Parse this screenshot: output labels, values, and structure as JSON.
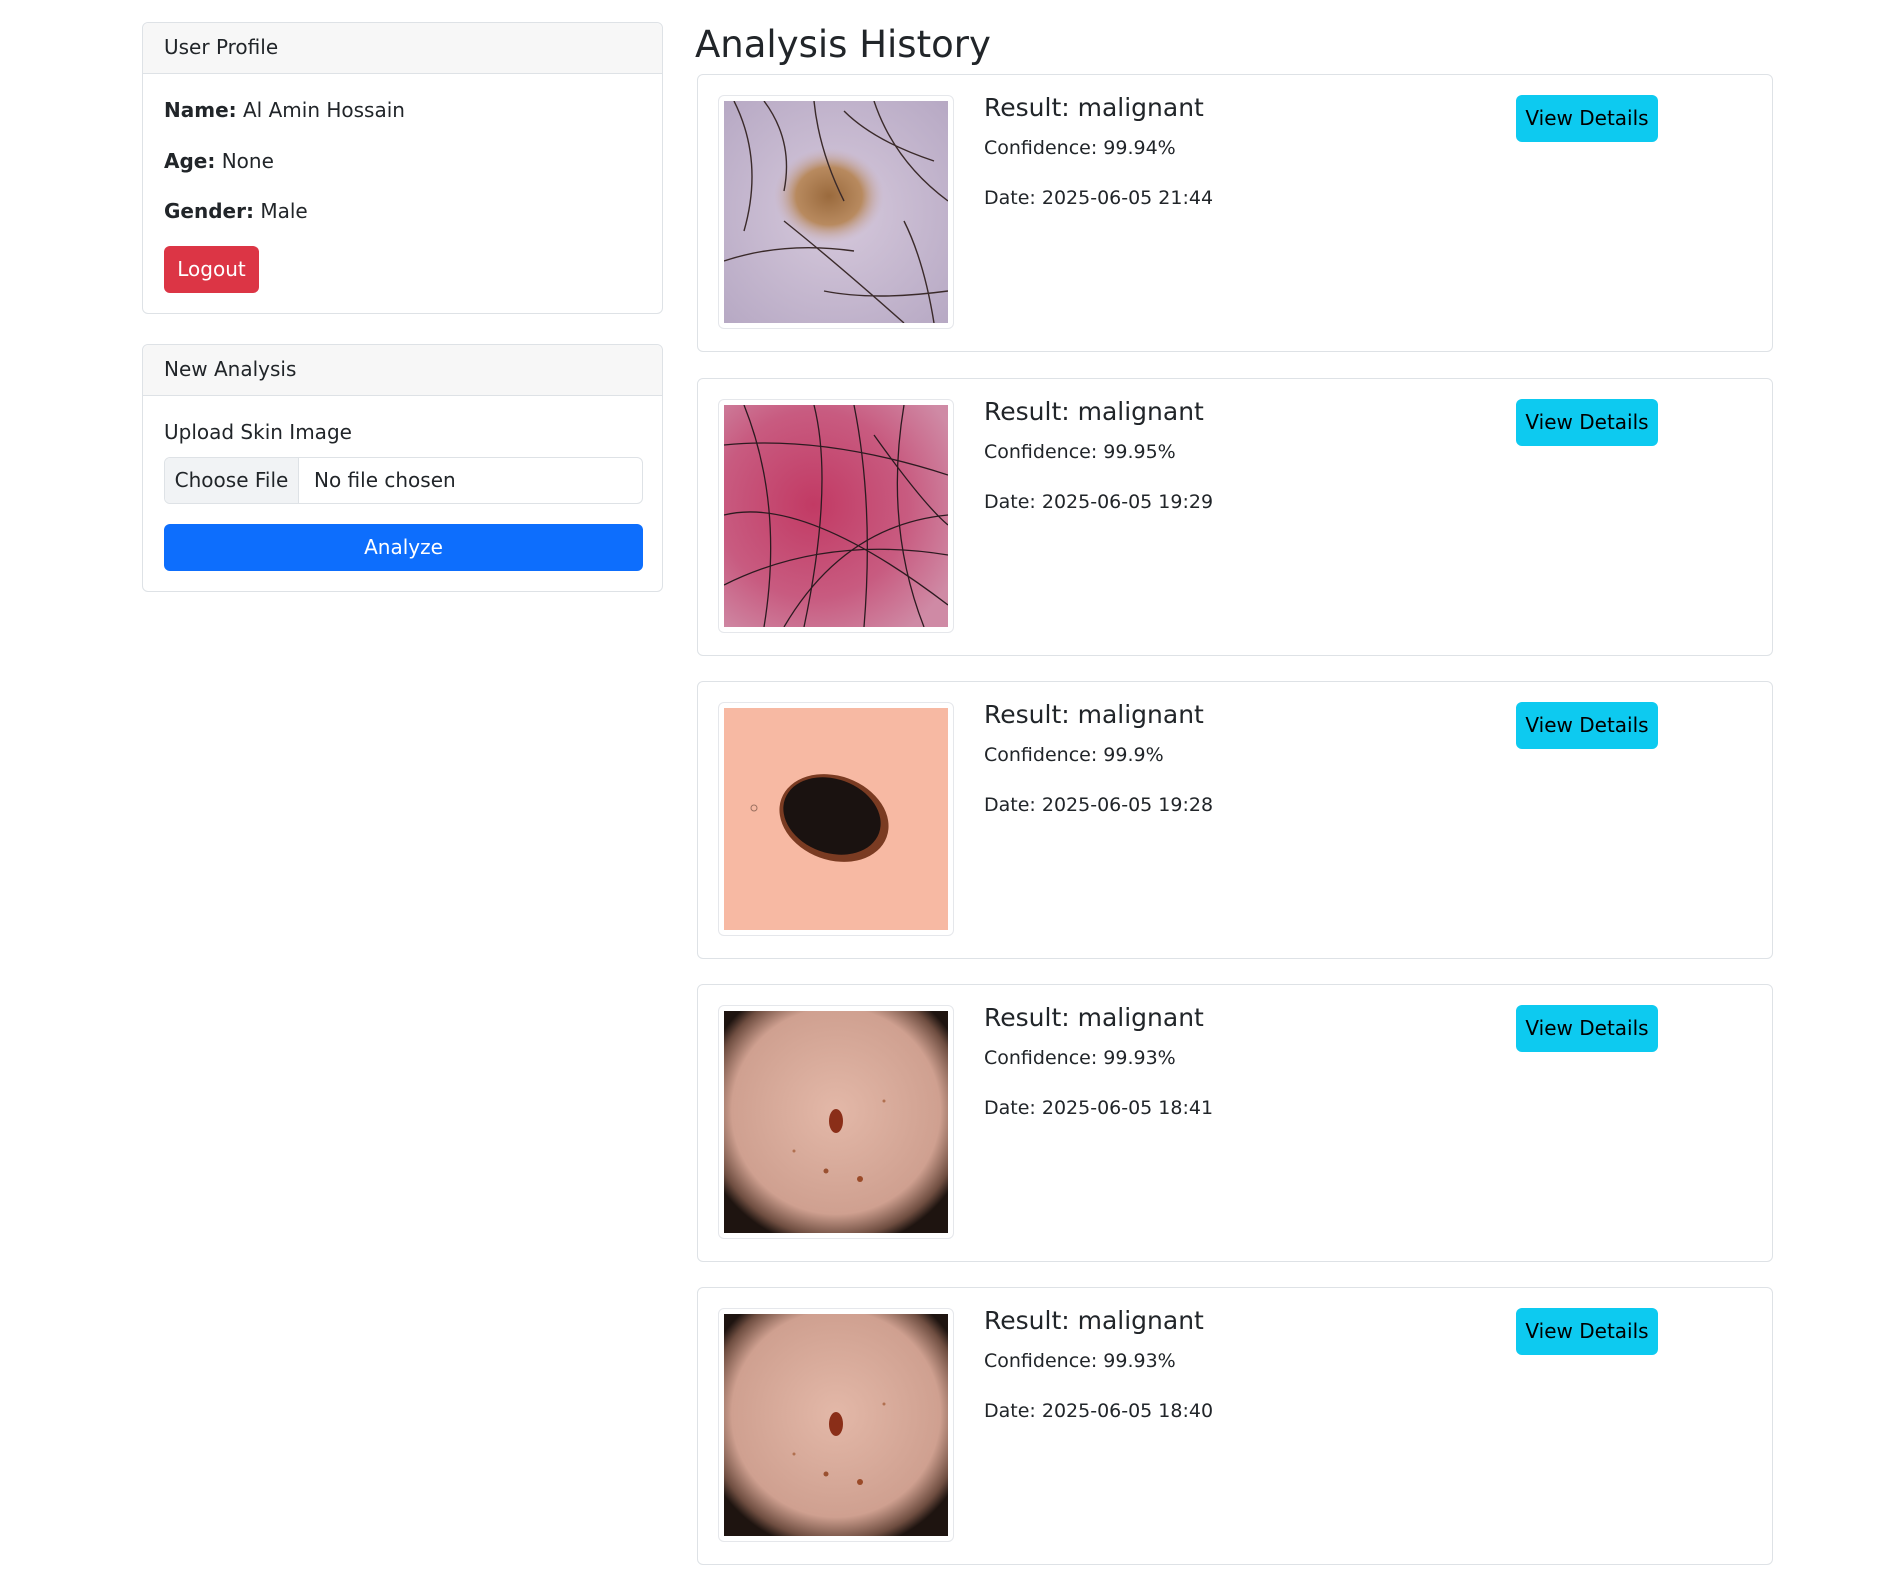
{
  "profile": {
    "header": "User Profile",
    "name_label": "Name:",
    "name_value": "Al Amin Hossain",
    "age_label": "Age:",
    "age_value": "None",
    "gender_label": "Gender:",
    "gender_value": "Male",
    "logout_label": "Logout"
  },
  "new_analysis": {
    "header": "New Analysis",
    "upload_label": "Upload Skin Image",
    "choose_file_label": "Choose File",
    "file_status": "No file chosen",
    "analyze_label": "Analyze"
  },
  "history": {
    "title": "Analysis History",
    "details_label": "View Details",
    "items": [
      {
        "result": "Result: malignant",
        "confidence": "Confidence: 99.94%",
        "date": "Date: 2025-06-05 21:44",
        "image": "skin-lesion-hairy-purple"
      },
      {
        "result": "Result: malignant",
        "confidence": "Confidence: 99.95%",
        "date": "Date: 2025-06-05 19:29",
        "image": "skin-lesion-red-hairy"
      },
      {
        "result": "Result: malignant",
        "confidence": "Confidence: 99.9%",
        "date": "Date: 2025-06-05 19:28",
        "image": "skin-lesion-dark-mole"
      },
      {
        "result": "Result: malignant",
        "confidence": "Confidence: 99.93%",
        "date": "Date: 2025-06-05 18:41",
        "image": "skin-lesion-small-mole"
      },
      {
        "result": "Result: malignant",
        "confidence": "Confidence: 99.93%",
        "date": "Date: 2025-06-05 18:40",
        "image": "skin-lesion-small-mole"
      }
    ]
  },
  "colors": {
    "danger": "#dc3545",
    "primary": "#0d6efd",
    "info": "#0dcaf0",
    "border": "#dee2e6"
  }
}
